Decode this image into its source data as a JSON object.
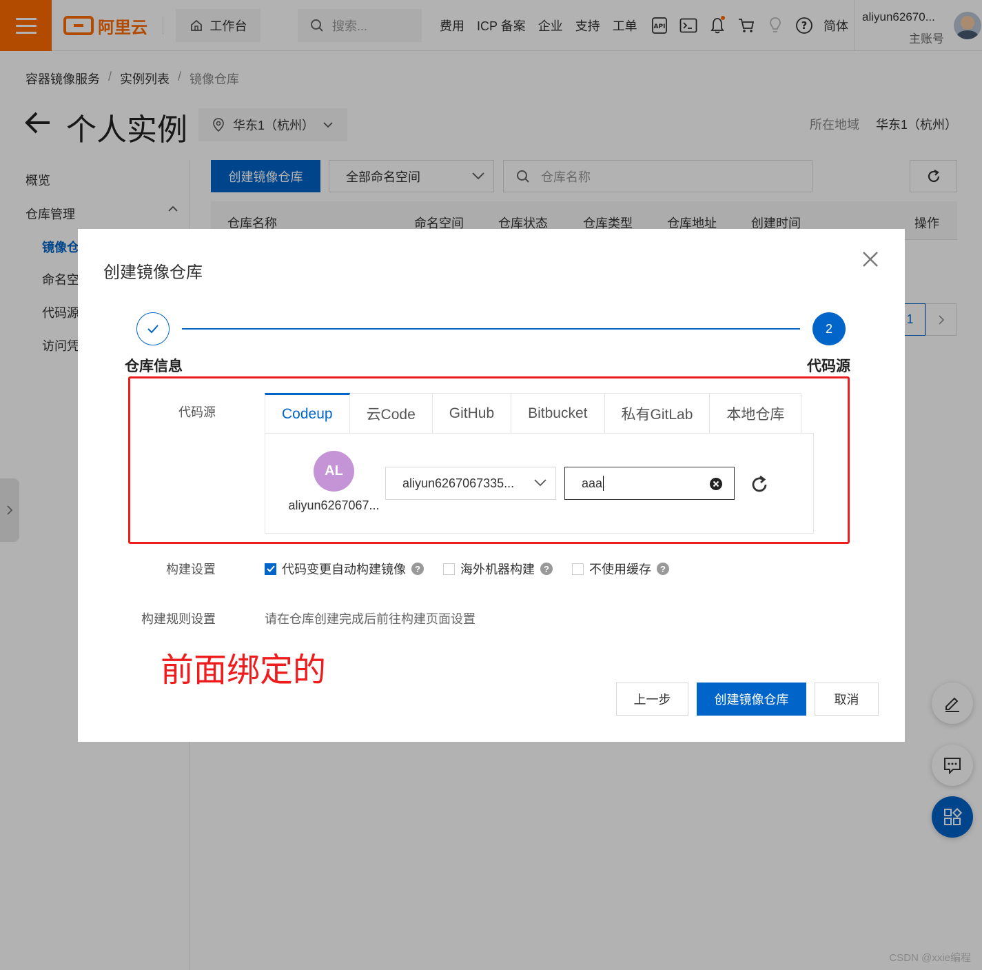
{
  "topbar": {
    "logo_text": "阿里云",
    "workbench": "工作台",
    "search_placeholder": "搜索...",
    "links": [
      "费用",
      "ICP 备案",
      "企业",
      "支持",
      "工单"
    ],
    "language": "简体",
    "account_name": "aliyun62670...",
    "account_role": "主账号"
  },
  "breadcrumb": [
    "容器镜像服务",
    "实例列表",
    "镜像仓库"
  ],
  "page": {
    "title": "个人实例",
    "region_select": "华东1（杭州）",
    "region_label": "所在地域",
    "region_value": "华东1（杭州）"
  },
  "sidebar": {
    "overview": "概览",
    "repo_mgmt": "仓库管理",
    "items": [
      "镜像仓",
      "命名空",
      "代码源",
      "访问凭"
    ]
  },
  "toolbar": {
    "create_button": "创建镜像仓库",
    "namespace_select": "全部命名空间",
    "repo_search_placeholder": "仓库名称"
  },
  "table": {
    "headers": [
      "仓库名称",
      "命名空间",
      "仓库状态",
      "仓库类型",
      "仓库地址",
      "创建时间",
      "操作"
    ]
  },
  "pager": {
    "current": "1"
  },
  "dialog": {
    "title": "创建镜像仓库",
    "steps": [
      {
        "label": "仓库信息",
        "state": "done"
      },
      {
        "label": "代码源",
        "number": "2",
        "state": "active"
      }
    ],
    "code_source_label": "代码源",
    "tabs": [
      "Codeup",
      "云Code",
      "GitHub",
      "Bitbucket",
      "私有GitLab",
      "本地仓库"
    ],
    "active_tab": "Codeup",
    "user_avatar": "AL",
    "user_name": "aliyun6267067...",
    "org_select": "aliyun6267067335...",
    "repo_input": "aaa",
    "build_settings_label": "构建设置",
    "build_options": [
      {
        "label": "代码变更自动构建镜像",
        "checked": true
      },
      {
        "label": "海外机器构建",
        "checked": false
      },
      {
        "label": "不使用缓存",
        "checked": false
      }
    ],
    "build_rules_label": "构建规则设置",
    "build_rules_text": "请在仓库创建完成后前往构建页面设置",
    "annotation": "前面绑定的",
    "buttons": {
      "prev": "上一步",
      "create": "创建镜像仓库",
      "cancel": "取消"
    }
  },
  "watermark": "CSDN @xxie编程",
  "colors": {
    "brand_orange": "#ff6a00",
    "primary_blue": "#0064c8",
    "annotation_red": "#ee1c1c"
  }
}
